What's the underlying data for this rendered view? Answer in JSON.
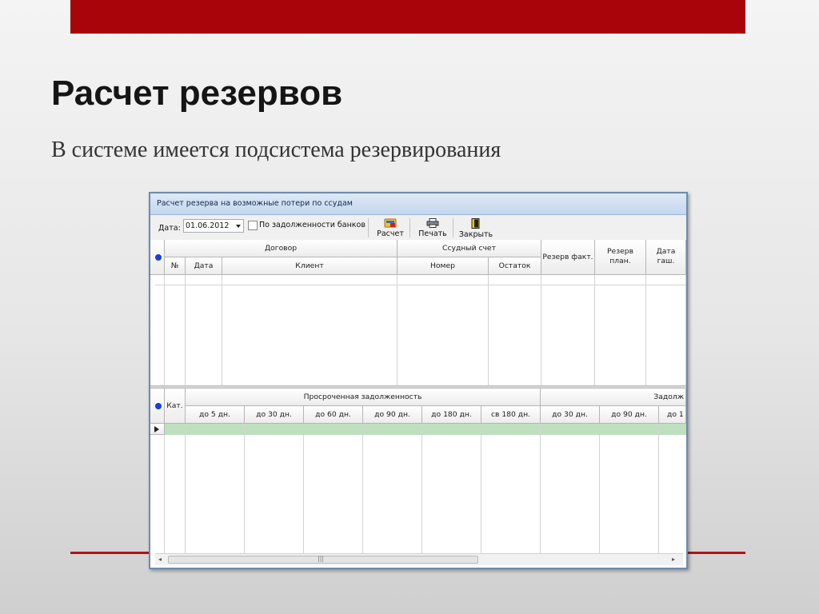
{
  "slide": {
    "title": "Расчет резервов",
    "subtitle": "В системе имеется подсистема резервирования"
  },
  "window": {
    "title": "Расчет резерва на возможные потери по ссудам"
  },
  "toolbar": {
    "date_label": "Дата:",
    "date_value": "01.06.2012",
    "checkbox_label": "По задолженности банков",
    "checkbox_checked": false,
    "calc_label": "Расчет",
    "print_label": "Печать",
    "close_label": "Закрыть"
  },
  "top_grid": {
    "group_contract": "Договор",
    "group_account": "Ссудный счет",
    "col_num": "№",
    "col_date": "Дата",
    "col_client": "Клиент",
    "col_number": "Номер",
    "col_balance": "Остаток",
    "col_reserve_fact": "Резерв факт.",
    "col_reserve_plan": "Резерв план.",
    "col_pay_date": "Дата гаш."
  },
  "bottom_grid": {
    "col_cat": "Кат.",
    "group_overdue": "Просроченная задолженность",
    "group_debt": "Задолж",
    "cols": [
      "до 5 дн.",
      "до 30 дн.",
      "до 60 дн.",
      "до 90 дн.",
      "до 180 дн.",
      "св 180 дн.",
      "до 30 дн.",
      "до 90 дн.",
      "до 1"
    ]
  },
  "colors": {
    "accent_red": "#a8040a",
    "window_border": "#6c8bb0",
    "selected_row": "#bfe0bf",
    "row_indicator": "#1b3be0"
  }
}
